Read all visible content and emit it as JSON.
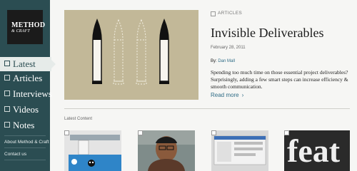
{
  "logo": {
    "line1": "METHOD",
    "line2": "& CRAFT"
  },
  "nav": [
    {
      "label": "Latest",
      "active": true
    },
    {
      "label": "Articles",
      "active": false
    },
    {
      "label": "Interviews",
      "active": false
    },
    {
      "label": "Videos",
      "active": false
    },
    {
      "label": "Notes",
      "active": false
    }
  ],
  "sidebar_links": [
    "About Method & Craft",
    "Contact us"
  ],
  "featured": {
    "tag": "ARTICLES",
    "title": "Invisible Deliverables",
    "date": "February 28, 2011",
    "by_label": "By:",
    "author": "Dan Mall",
    "summary": "Spending too much time on those essential project deliverables? Surprisingly, adding a few smart steps can increase efficiency & smooth communication.",
    "read_more": "Read more"
  },
  "latest_label": "Latest Content",
  "thumbnails": [
    {
      "kind": "screenshot"
    },
    {
      "kind": "photo"
    },
    {
      "kind": "screenshot"
    },
    {
      "kind": "lettering",
      "text": "feat"
    }
  ],
  "colors": {
    "sidebar": "#2b4d52",
    "accent": "#2f6c86",
    "hero_bg": "#c2b898"
  }
}
